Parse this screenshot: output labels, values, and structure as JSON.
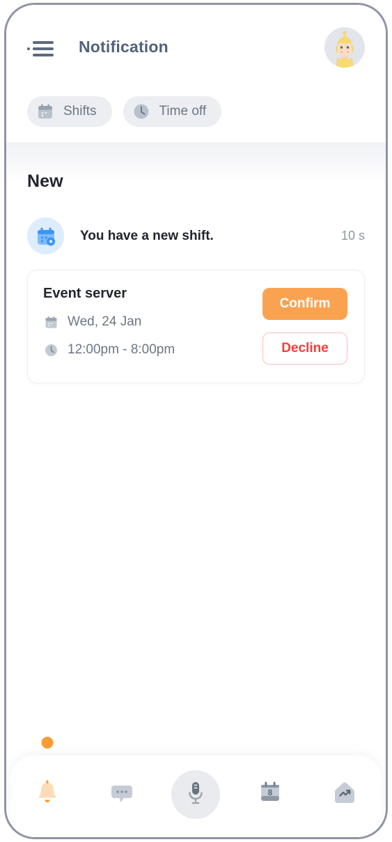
{
  "header": {
    "title": "Notification",
    "menu_icon": "hamburger-menu-icon",
    "avatar_alt": "user-avatar"
  },
  "filters": [
    {
      "label": "Shifts",
      "icon": "calendar-icon"
    },
    {
      "label": "Time off",
      "icon": "clock-icon"
    }
  ],
  "content": {
    "section_title": "New",
    "notification": {
      "icon": "calendar-settings-icon",
      "message": "You have a new shift.",
      "time": "10 s"
    },
    "card": {
      "title": "Event server",
      "date_icon": "calendar-icon",
      "date": "Wed, 24 Jan",
      "time_icon": "clock-icon",
      "time": "12:00pm - 8:00pm",
      "confirm_label": "Confirm",
      "decline_label": "Decline"
    }
  },
  "bottom_nav": [
    {
      "name": "notifications",
      "icon": "bell-icon",
      "active": true
    },
    {
      "name": "messages",
      "icon": "chat-bubble-icon",
      "active": false
    },
    {
      "name": "voice",
      "icon": "microphone-icon",
      "active": false
    },
    {
      "name": "schedule",
      "icon": "calendar-day-icon",
      "day": "8",
      "active": false
    },
    {
      "name": "insights",
      "icon": "trending-up-icon",
      "active": false
    }
  ],
  "colors": {
    "accent_orange": "#f9a351",
    "decline_red": "#fb3b3b",
    "icon_gray": "#aeb6c2",
    "blue_icon": "#4a9cf6",
    "title_gray": "#53627a"
  }
}
